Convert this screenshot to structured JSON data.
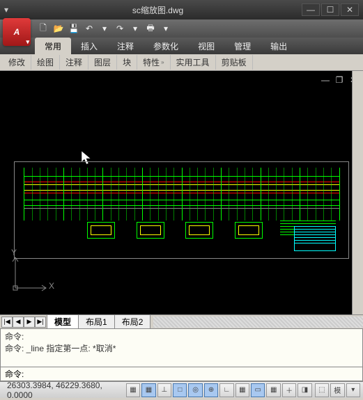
{
  "window": {
    "title": "sc缩放图.dwg",
    "min": "—",
    "max": "☐",
    "close": "✕"
  },
  "logo": "A",
  "qat": {
    "new": "🗋",
    "open": "📂",
    "save": "💾",
    "undo": "↶",
    "redo": "↷",
    "print": "🖶",
    "more": "▾"
  },
  "ribbon": {
    "tabs": [
      "常用",
      "插入",
      "注释",
      "参数化",
      "视图",
      "管理",
      "输出"
    ],
    "active": 0
  },
  "panels": [
    "修改",
    "绘图",
    "注释",
    "图层",
    "块",
    "特性",
    "实用工具",
    "剪贴板"
  ],
  "layout": {
    "nav": [
      "|◀",
      "◀",
      "▶",
      "▶|"
    ],
    "tabs": [
      "模型",
      "布局1",
      "布局2"
    ],
    "active": 0
  },
  "ucs": {
    "x": "X",
    "y": "Y"
  },
  "cmd": {
    "line1": "命令:",
    "line2": "命令: _line 指定第一点: *取消*",
    "line3": "",
    "prompt": "命令:"
  },
  "status": {
    "coords": "26303.3984, 46229.3680, 0.0000",
    "buttons": [
      "▦",
      "▦",
      "⊥",
      "□",
      "◎",
      "⊕",
      "∟",
      "▦",
      "▭",
      "▦",
      "＋",
      "◨",
      "⬚",
      "模",
      "▾"
    ]
  }
}
